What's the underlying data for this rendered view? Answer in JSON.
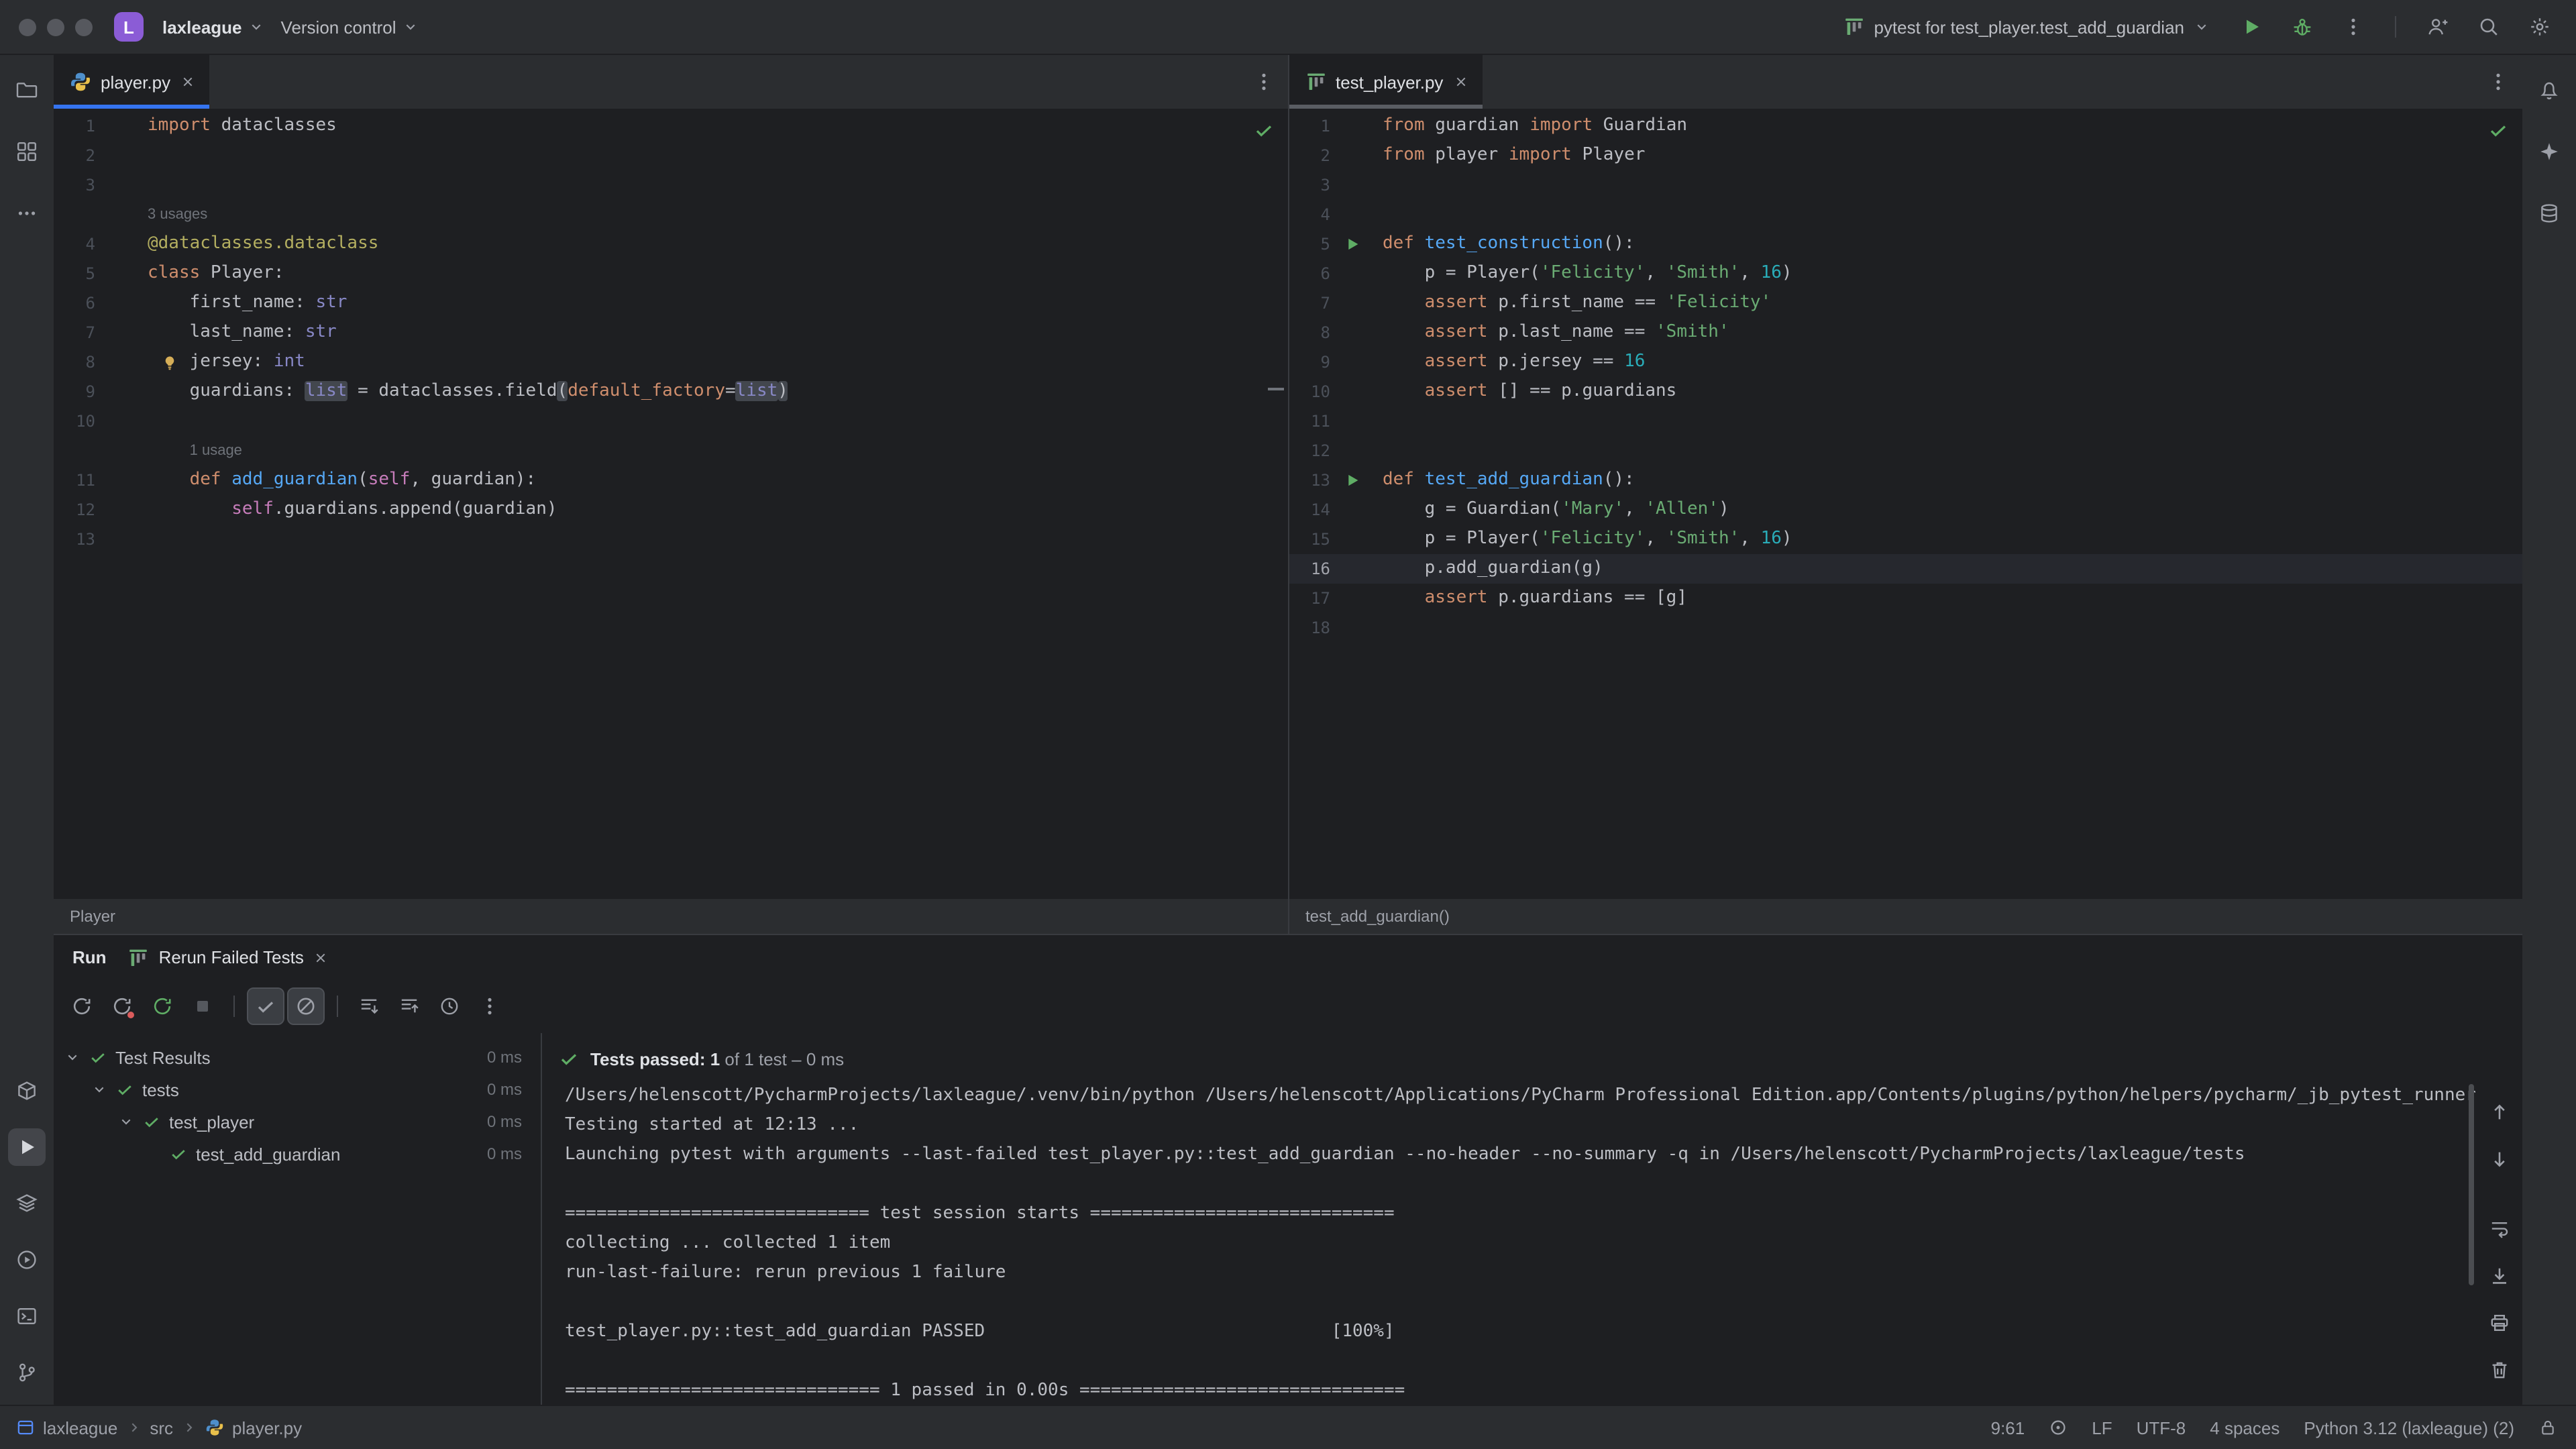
{
  "titlebar": {
    "project_initial": "L",
    "project_name": "laxleague",
    "menu_version_control": "Version control",
    "run_config": "pytest for test_player.test_add_guardian"
  },
  "colors": {
    "accent": "#3574F0",
    "green": "#5FAD65",
    "keyword": "#CF8E6D",
    "string": "#6AAB73",
    "number": "#2AACB8",
    "function": "#56A8F5",
    "decorator": "#B3AE60",
    "builtin": "#8888C6",
    "self": "#C77DBB",
    "editor_bg": "#1E1F22",
    "panel_bg": "#2B2D30"
  },
  "icons": {
    "titlebar": [
      "pytest-icon",
      "run-icon",
      "debug-bug-icon",
      "more-vertical-icon",
      "add-person-icon",
      "search-icon",
      "gear-icon"
    ],
    "left_stripe": [
      "folder-icon",
      "structure-icon",
      "more-icon",
      "package-icon",
      "run-icon",
      "services-icon",
      "python-console-icon",
      "terminal-icon",
      "git-branch-icon"
    ],
    "right_stripe": [
      "bell-icon",
      "ai-sparkle-icon",
      "database-icon"
    ]
  },
  "editors": [
    {
      "tab": "player.py",
      "breadcrumb": "Player",
      "lines": [
        {
          "n": "1",
          "s": [
            [
              "kw",
              "import"
            ],
            [
              "p",
              " dataclasses"
            ]
          ]
        },
        {
          "n": "2",
          "s": []
        },
        {
          "n": "3",
          "s": []
        },
        {
          "inlay": "3 usages",
          "pad": 0
        },
        {
          "n": "4",
          "s": [
            [
              "deco",
              "@dataclasses.dataclass"
            ]
          ]
        },
        {
          "n": "5",
          "s": [
            [
              "kw",
              "class"
            ],
            [
              "p",
              " Player:"
            ]
          ]
        },
        {
          "n": "6",
          "s": [
            [
              "p",
              "    first_name: "
            ],
            [
              "bi",
              "str"
            ]
          ]
        },
        {
          "n": "7",
          "s": [
            [
              "p",
              "    last_name: "
            ],
            [
              "bi",
              "str"
            ]
          ]
        },
        {
          "n": "8",
          "bulb": true,
          "s": [
            [
              "p",
              "    jersey: "
            ],
            [
              "bi",
              "int"
            ]
          ]
        },
        {
          "n": "9",
          "s": [
            [
              "p",
              "    guardians: "
            ],
            [
              "bi hl",
              "list"
            ],
            [
              "p",
              " = dataclasses.field"
            ],
            [
              "p hl",
              "("
            ],
            [
              "kwarg",
              "default_factory"
            ],
            [
              "p",
              "="
            ],
            [
              "bi hl",
              "list"
            ],
            [
              "p hl",
              ")"
            ]
          ]
        },
        {
          "n": "10",
          "s": []
        },
        {
          "inlay": "1 usage",
          "pad": 4
        },
        {
          "n": "11",
          "s": [
            [
              "p",
              "    "
            ],
            [
              "kw",
              "def"
            ],
            [
              "fn",
              " add_guardian"
            ],
            [
              "p",
              "("
            ],
            [
              "self",
              "self"
            ],
            [
              "p",
              ", guardian):"
            ]
          ]
        },
        {
          "n": "12",
          "s": [
            [
              "p",
              "        "
            ],
            [
              "self",
              "self"
            ],
            [
              "p",
              ".guardians.append(guardian)"
            ]
          ]
        },
        {
          "n": "13",
          "s": []
        }
      ]
    },
    {
      "tab": "test_player.py",
      "breadcrumb": "test_add_guardian()",
      "lines": [
        {
          "n": "1",
          "s": [
            [
              "kw",
              "from"
            ],
            [
              "p",
              " guardian "
            ],
            [
              "kw",
              "import"
            ],
            [
              "p",
              " Guardian"
            ]
          ]
        },
        {
          "n": "2",
          "s": [
            [
              "kw",
              "from"
            ],
            [
              "p",
              " player "
            ],
            [
              "kw",
              "import"
            ],
            [
              "p",
              " Player"
            ]
          ]
        },
        {
          "n": "3",
          "s": []
        },
        {
          "n": "4",
          "s": []
        },
        {
          "n": "5",
          "run": true,
          "s": [
            [
              "kw",
              "def"
            ],
            [
              "fn",
              " test_construction"
            ],
            [
              "p",
              "():"
            ]
          ]
        },
        {
          "n": "6",
          "s": [
            [
              "p",
              "    p = Player("
            ],
            [
              "str",
              "'Felicity'"
            ],
            [
              "p",
              ", "
            ],
            [
              "str",
              "'Smith'"
            ],
            [
              "p",
              ", "
            ],
            [
              "num",
              "16"
            ],
            [
              "p",
              ")"
            ]
          ]
        },
        {
          "n": "7",
          "s": [
            [
              "p",
              "    "
            ],
            [
              "kw",
              "assert"
            ],
            [
              "p",
              " p.first_name == "
            ],
            [
              "str",
              "'Felicity'"
            ]
          ]
        },
        {
          "n": "8",
          "s": [
            [
              "p",
              "    "
            ],
            [
              "kw",
              "assert"
            ],
            [
              "p",
              " p.last_name == "
            ],
            [
              "str",
              "'Smith'"
            ]
          ]
        },
        {
          "n": "9",
          "s": [
            [
              "p",
              "    "
            ],
            [
              "kw",
              "assert"
            ],
            [
              "p",
              " p.jersey == "
            ],
            [
              "num",
              "16"
            ]
          ]
        },
        {
          "n": "10",
          "s": [
            [
              "p",
              "    "
            ],
            [
              "kw",
              "assert"
            ],
            [
              "p",
              " [] == p.guardians"
            ]
          ]
        },
        {
          "n": "11",
          "s": []
        },
        {
          "n": "12",
          "s": []
        },
        {
          "n": "13",
          "run": true,
          "s": [
            [
              "kw",
              "def"
            ],
            [
              "fn",
              " test_add_guardian"
            ],
            [
              "p",
              "():"
            ]
          ]
        },
        {
          "n": "14",
          "s": [
            [
              "p",
              "    g = Guardian("
            ],
            [
              "str",
              "'Mary'"
            ],
            [
              "p",
              ", "
            ],
            [
              "str",
              "'Allen'"
            ],
            [
              "p",
              ")"
            ]
          ]
        },
        {
          "n": "15",
          "s": [
            [
              "p",
              "    p = Player("
            ],
            [
              "str",
              "'Felicity'"
            ],
            [
              "p",
              ", "
            ],
            [
              "str",
              "'Smith'"
            ],
            [
              "p",
              ", "
            ],
            [
              "num",
              "16"
            ],
            [
              "p",
              ")"
            ]
          ]
        },
        {
          "n": "16",
          "current": true,
          "s": [
            [
              "p",
              "    p.add_guardian(g)"
            ]
          ]
        },
        {
          "n": "17",
          "s": [
            [
              "p",
              "    "
            ],
            [
              "kw",
              "assert"
            ],
            [
              "p",
              " p.guardians == [g]"
            ]
          ]
        },
        {
          "n": "18",
          "s": []
        }
      ]
    }
  ],
  "run_panel": {
    "window_title": "Run",
    "tab_label": "Rerun Failed Tests",
    "tree": [
      {
        "level": 0,
        "label": "Test Results",
        "time": "0 ms"
      },
      {
        "level": 1,
        "label": "tests",
        "time": "0 ms"
      },
      {
        "level": 2,
        "label": "test_player",
        "time": "0 ms"
      },
      {
        "level": 3,
        "leaf": true,
        "label": "test_add_guardian",
        "time": "0 ms"
      }
    ],
    "summary": {
      "strong": "Tests passed: 1",
      "rest": " of 1 test – 0 ms"
    },
    "console_lines": [
      "/Users/helenscott/PycharmProjects/laxleague/.venv/bin/python /Users/helenscott/Applications/PyCharm Professional Edition.app/Contents/plugins/python/helpers/pycharm/_jb_pytest_runner",
      "Testing started at 12:13 ...",
      "Launching pytest with arguments --last-failed test_player.py::test_add_guardian --no-header --no-summary -q in /Users/helenscott/PycharmProjects/laxleague/tests",
      "",
      "============================= test session starts =============================",
      "collecting ... collected 1 item",
      "run-last-failure: rerun previous 1 failure",
      "",
      "test_player.py::test_add_guardian PASSED                                 [100%]",
      "",
      "============================== 1 passed in 0.00s ==============================="
    ]
  },
  "statusbar": {
    "crumbs": [
      "laxleague",
      "src",
      "player.py"
    ],
    "caret": "9:61",
    "line_ending": "LF",
    "encoding": "UTF-8",
    "indent": "4 spaces",
    "interpreter": "Python 3.12 (laxleague) (2)"
  }
}
